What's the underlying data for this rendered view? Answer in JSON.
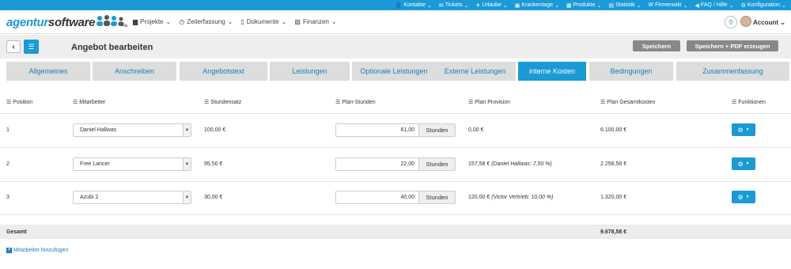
{
  "topbar": {
    "items": [
      {
        "label": "Kontakte",
        "icon": "user-icon"
      },
      {
        "label": "Tickets",
        "icon": "ticket-icon"
      },
      {
        "label": "Urlaube",
        "icon": "plane-icon"
      },
      {
        "label": "Krankentage",
        "icon": "camera-icon"
      },
      {
        "label": "Produkte",
        "icon": "box-icon"
      },
      {
        "label": "Statistik",
        "icon": "chart-icon"
      },
      {
        "label": "Firmenwiki",
        "icon": "wiki-icon"
      },
      {
        "label": "FAQ / Hilfe",
        "icon": "bullhorn-icon"
      },
      {
        "label": "Konfiguration",
        "icon": "gears-icon"
      }
    ]
  },
  "header": {
    "logo_part1": "agentur",
    "logo_part2": "software",
    "logo_badge": "de",
    "nav": [
      {
        "label": "Projekte",
        "icon": "briefcase-icon"
      },
      {
        "label": "Zeiterfassung",
        "icon": "clock-icon"
      },
      {
        "label": "Dokumente",
        "icon": "document-icon"
      },
      {
        "label": "Finanzen",
        "icon": "money-icon"
      }
    ],
    "account_label": "Account"
  },
  "toolbar": {
    "title": "Angebot bearbeiten",
    "save_label": "Speichern",
    "save_pdf_label": "Speichern + PDF erzeugen"
  },
  "tabs": [
    {
      "label": "Allgemeines",
      "active": false
    },
    {
      "label": "Anschreiben",
      "active": false
    },
    {
      "label": "Angebotstext",
      "active": false
    },
    {
      "label": "Leistungen",
      "active": false
    },
    {
      "label": "Optionale Leistungen",
      "active": false
    },
    {
      "label": "Externe Leistungen",
      "active": false
    },
    {
      "label": "interne Kosten",
      "active": true
    },
    {
      "label": "Bedingungen",
      "active": false
    },
    {
      "label": "Zusammenfassung",
      "active": false
    }
  ],
  "table": {
    "headers": {
      "position": "Position",
      "mitarbeiter": "Mitarbeiter",
      "stundensatz": "Stundensatz",
      "plan_stunden": "Plan-Stunden",
      "plan_provision": "Plan Provision",
      "plan_gesamtkosten": "Plan Gesamtkosten",
      "funktionen": "Funktionen"
    },
    "rows": [
      {
        "position": "1",
        "mitarbeiter": "Daniel Hallwas",
        "stundensatz": "100,00 €",
        "plan_stunden": "61,00",
        "unit": "Stunden",
        "provision": "0,00 €",
        "provision_note": "",
        "gesamtkosten": "6.100,00 €"
      },
      {
        "position": "2",
        "mitarbeiter": "Free Lancer",
        "stundensatz": "95,50 €",
        "plan_stunden": "22,00",
        "unit": "Stunden",
        "provision": "157,58 €",
        "provision_note": "(Daniel Hallwas: 7,50 %)",
        "gesamtkosten": "2.258,58 €"
      },
      {
        "position": "3",
        "mitarbeiter": "Azubi 2",
        "stundensatz": "30,00 €",
        "plan_stunden": "40,00",
        "unit": "Stunden",
        "provision": "120,00 €",
        "provision_note": "(Victor Vertrieb: 10,00 %)",
        "gesamtkosten": "1.320,00 €"
      }
    ],
    "total_label": "Gesamt",
    "total_value": "9.678,58 €"
  },
  "add_link_label": "Mitarbeiter hinzufügen",
  "colors": {
    "accent": "#1a9ad6",
    "tab_inactive": "#dddddd",
    "button_gray": "#888888"
  }
}
